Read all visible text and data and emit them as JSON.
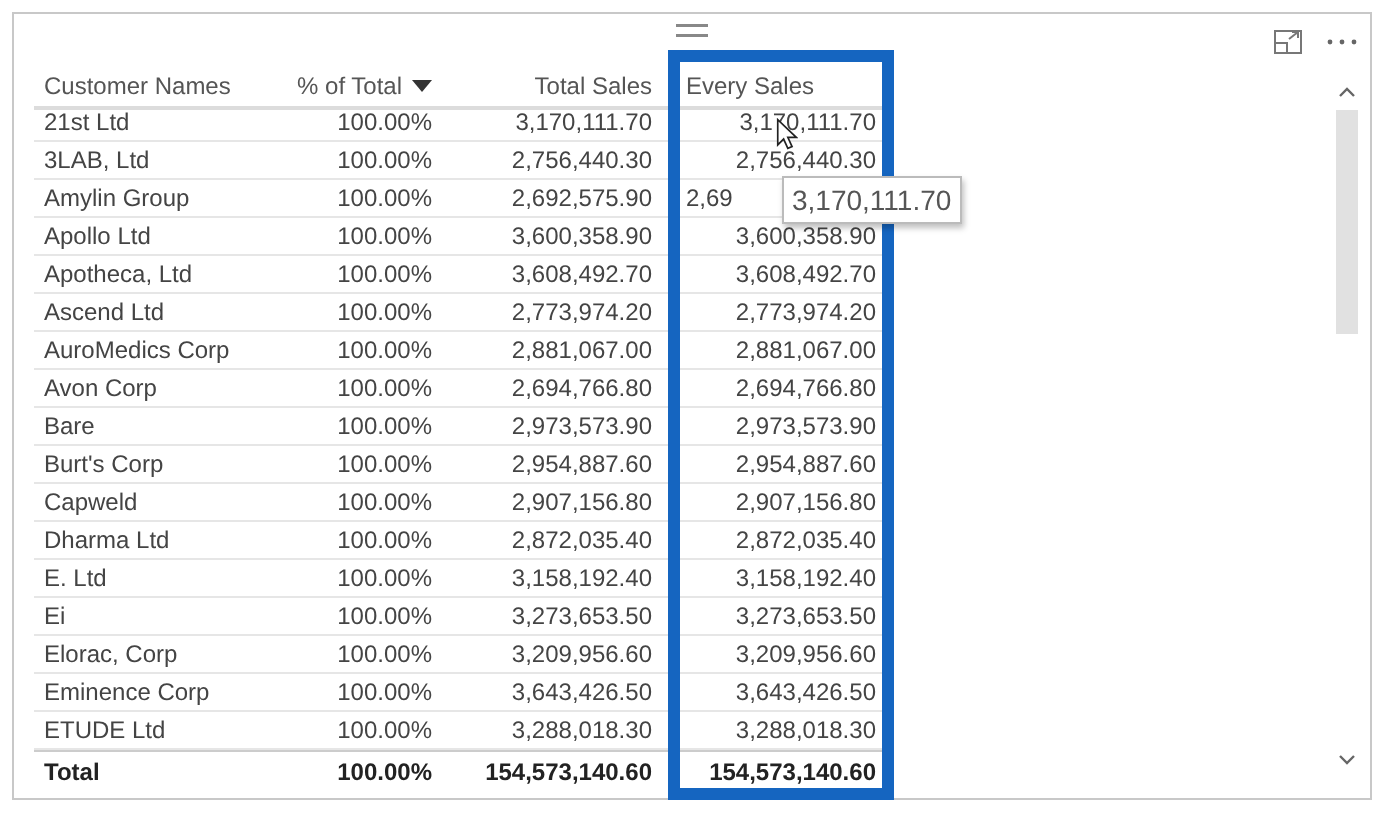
{
  "columns": [
    {
      "label": "Customer Names",
      "sorted": false
    },
    {
      "label": "% of Total",
      "sorted": true
    },
    {
      "label": "Total Sales",
      "sorted": false
    },
    {
      "label": "Every Sales",
      "sorted": false
    }
  ],
  "rows": [
    {
      "name": "21st Ltd",
      "pct": "100.00%",
      "total": "3,170,111.70",
      "every": "3,170,111.70",
      "covered": false
    },
    {
      "name": "3LAB, Ltd",
      "pct": "100.00%",
      "total": "2,756,440.30",
      "every": "2,756,440.30",
      "covered": false
    },
    {
      "name": "Amylin Group",
      "pct": "100.00%",
      "total": "2,692,575.90",
      "every": "2,69",
      "covered": true
    },
    {
      "name": "Apollo Ltd",
      "pct": "100.00%",
      "total": "3,600,358.90",
      "every": "3,600,358.90",
      "covered": false
    },
    {
      "name": "Apotheca, Ltd",
      "pct": "100.00%",
      "total": "3,608,492.70",
      "every": "3,608,492.70",
      "covered": false
    },
    {
      "name": "Ascend Ltd",
      "pct": "100.00%",
      "total": "2,773,974.20",
      "every": "2,773,974.20",
      "covered": false
    },
    {
      "name": "AuroMedics Corp",
      "pct": "100.00%",
      "total": "2,881,067.00",
      "every": "2,881,067.00",
      "covered": false
    },
    {
      "name": "Avon Corp",
      "pct": "100.00%",
      "total": "2,694,766.80",
      "every": "2,694,766.80",
      "covered": false
    },
    {
      "name": "Bare",
      "pct": "100.00%",
      "total": "2,973,573.90",
      "every": "2,973,573.90",
      "covered": false
    },
    {
      "name": "Burt's Corp",
      "pct": "100.00%",
      "total": "2,954,887.60",
      "every": "2,954,887.60",
      "covered": false
    },
    {
      "name": "Capweld",
      "pct": "100.00%",
      "total": "2,907,156.80",
      "every": "2,907,156.80",
      "covered": false
    },
    {
      "name": "Dharma Ltd",
      "pct": "100.00%",
      "total": "2,872,035.40",
      "every": "2,872,035.40",
      "covered": false
    },
    {
      "name": "E. Ltd",
      "pct": "100.00%",
      "total": "3,158,192.40",
      "every": "3,158,192.40",
      "covered": false
    },
    {
      "name": "Ei",
      "pct": "100.00%",
      "total": "3,273,653.50",
      "every": "3,273,653.50",
      "covered": false
    },
    {
      "name": "Elorac, Corp",
      "pct": "100.00%",
      "total": "3,209,956.60",
      "every": "3,209,956.60",
      "covered": false
    },
    {
      "name": "Eminence Corp",
      "pct": "100.00%",
      "total": "3,643,426.50",
      "every": "3,643,426.50",
      "covered": false
    },
    {
      "name": "ETUDE Ltd",
      "pct": "100.00%",
      "total": "3,288,018.30",
      "every": "3,288,018.30",
      "covered": false
    }
  ],
  "total": {
    "name": "Total",
    "pct": "100.00%",
    "total": "154,573,140.60",
    "every": "154,573,140.60"
  },
  "tooltip": {
    "text": "3,170,111.70"
  }
}
